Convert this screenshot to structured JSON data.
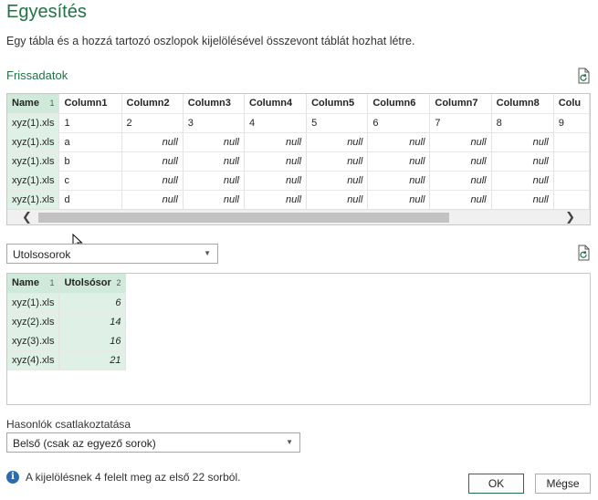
{
  "dialog": {
    "title": "Egyesítés",
    "description": "Egy tábla és a hozzá tartozó oszlopok kijelölésével összevont táblát hozhat létre."
  },
  "first_table": {
    "label": "Frissadatok",
    "columns": [
      "Name",
      "Column1",
      "Column2",
      "Column3",
      "Column4",
      "Column5",
      "Column6",
      "Column7",
      "Column8",
      "Colu"
    ],
    "selected_column_order": "1",
    "rows": [
      [
        "xyz(1).xls",
        "1",
        "2",
        "3",
        "4",
        "5",
        "6",
        "7",
        "8",
        "9"
      ],
      [
        "xyz(1).xls",
        "a",
        "null",
        "null",
        "null",
        "null",
        "null",
        "null",
        "null",
        ""
      ],
      [
        "xyz(1).xls",
        "b",
        "null",
        "null",
        "null",
        "null",
        "null",
        "null",
        "null",
        ""
      ],
      [
        "xyz(1).xls",
        "c",
        "null",
        "null",
        "null",
        "null",
        "null",
        "null",
        "null",
        ""
      ],
      [
        "xyz(1).xls",
        "d",
        "null",
        "null",
        "null",
        "null",
        "null",
        "null",
        "null",
        ""
      ]
    ]
  },
  "second_table": {
    "selected": "Utolsosorok",
    "columns": [
      "Name",
      "Utolsósor"
    ],
    "column_orders": [
      "1",
      "2"
    ],
    "rows": [
      [
        "xyz(1).xls",
        "6"
      ],
      [
        "xyz(2).xls",
        "14"
      ],
      [
        "xyz(3).xls",
        "16"
      ],
      [
        "xyz(4).xls",
        "21"
      ]
    ]
  },
  "join": {
    "label": "Hasonlók csatlakoztatása",
    "selected": "Belső (csak az egyező sorok)"
  },
  "status": {
    "text": "A kijelölésnek 4 felelt meg az első 22 sorból."
  },
  "buttons": {
    "ok": "OK",
    "cancel": "Mégse"
  },
  "colors": {
    "accent": "#217346",
    "key_column": "#dff1e6",
    "info": "#2b6cb0"
  }
}
